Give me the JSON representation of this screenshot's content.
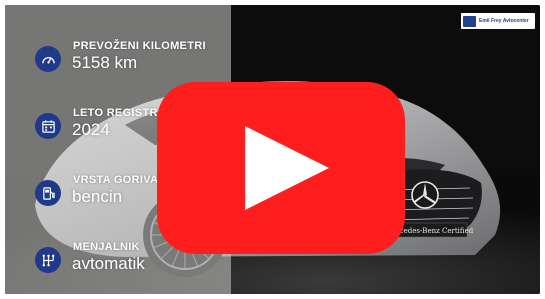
{
  "video": {
    "play_button_color": "#ff1e1e"
  },
  "dealer": {
    "name": "Emil Frey Avtocenter"
  },
  "car": {
    "plate_text": "Mercedes-Benz Certified"
  },
  "specs": [
    {
      "label": "PREVOŽENI KILOMETRI",
      "value": "5158 km",
      "icon": "speedometer-icon"
    },
    {
      "label": "LETO REGISTRACIJE",
      "value": "2024",
      "icon": "calendar-icon"
    },
    {
      "label": "VRSTA GORIVA",
      "value": "bencin",
      "icon": "fuel-pump-icon"
    },
    {
      "label": "MENJALNIK",
      "value": "avtomatik",
      "icon": "gearbox-icon"
    }
  ],
  "colors": {
    "icon_bg": "#1f3a8a",
    "panel_overlay": "rgba(205,208,204,0.55)"
  }
}
